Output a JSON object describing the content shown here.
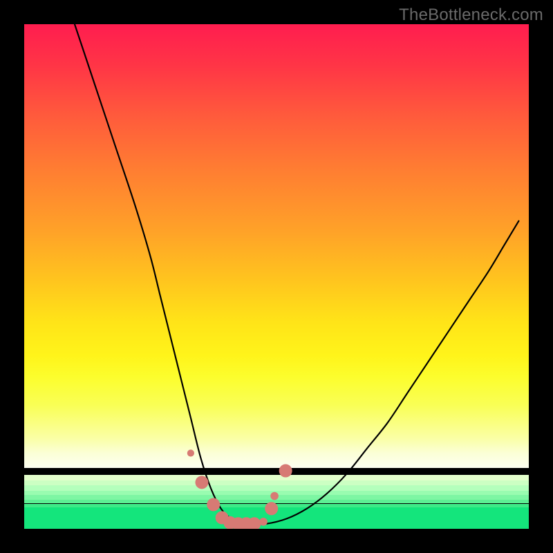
{
  "branding": {
    "text": "TheBottleneck.com"
  },
  "colors": {
    "page_bg": "#000000",
    "curve": "#000000",
    "marker_fill": "#d77a74",
    "gradient_top": "#ff1d4f",
    "gradient_mid": "#ffe418",
    "gradient_lower": "#faffa5",
    "green_base": "#14e57c"
  },
  "chart_data": {
    "type": "line",
    "title": "",
    "xlabel": "",
    "ylabel": "",
    "xlim": [
      0,
      100
    ],
    "ylim": [
      0,
      100
    ],
    "grid": false,
    "legend": false,
    "series": [
      {
        "name": "bottleneck-curve",
        "x": [
          10,
          14,
          18,
          22,
          25,
          27,
          29,
          31,
          33,
          35,
          37,
          39,
          41,
          43,
          45,
          48,
          52,
          56,
          60,
          64,
          68,
          72,
          76,
          80,
          84,
          88,
          92,
          95,
          98
        ],
        "y": [
          100,
          88,
          76,
          64,
          54,
          46,
          38,
          30,
          22,
          14,
          8,
          4,
          2,
          1,
          1,
          1,
          2,
          4,
          7,
          11,
          16,
          21,
          27,
          33,
          39,
          45,
          51,
          56,
          61
        ]
      }
    ],
    "markers": {
      "name": "highlighted-points",
      "x": [
        33.0,
        35.2,
        37.5,
        39.2,
        40.8,
        42.4,
        44.0,
        45.6,
        47.4,
        49.0,
        49.6,
        51.8
      ],
      "y": [
        15.0,
        9.2,
        4.8,
        2.2,
        1.2,
        1.0,
        1.0,
        1.0,
        1.4,
        4.0,
        6.5,
        11.5
      ],
      "size_pct": [
        1.4,
        2.6,
        2.6,
        2.6,
        2.6,
        2.6,
        2.6,
        2.6,
        1.6,
        2.6,
        1.6,
        2.6
      ]
    },
    "background_bands": [
      {
        "from_pct": 82.0,
        "to_pct": 88.0,
        "gradient": "yellow-to-pale"
      },
      {
        "from_pct": 88.0,
        "to_pct": 89.3,
        "color": "#f4ffcf"
      },
      {
        "from_pct": 89.3,
        "to_pct": 90.4,
        "color": "#e3ffcb"
      },
      {
        "from_pct": 90.4,
        "to_pct": 91.4,
        "color": "#ccffc3"
      },
      {
        "from_pct": 91.4,
        "to_pct": 92.4,
        "color": "#b4ffbc"
      },
      {
        "from_pct": 92.4,
        "to_pct": 93.3,
        "color": "#99fcb0"
      },
      {
        "from_pct": 93.3,
        "to_pct": 94.2,
        "color": "#7df6a3"
      },
      {
        "from_pct": 94.2,
        "to_pct": 95.0,
        "color": "#5def94"
      },
      {
        "from_pct": 95.0,
        "to_pct": 95.8,
        "color": "#3dea87"
      },
      {
        "from_pct": 95.8,
        "to_pct": 100.0,
        "color": "#14e57c"
      }
    ]
  }
}
